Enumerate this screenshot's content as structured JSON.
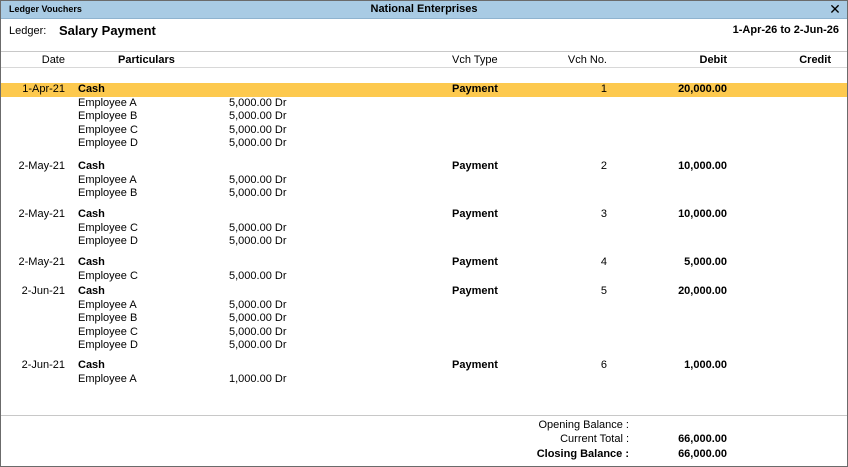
{
  "window": {
    "left_title": "Ledger Vouchers",
    "center_title": "National Enterprises",
    "close_glyph": "✕"
  },
  "ledger": {
    "label": "Ledger:",
    "name": "Salary Payment",
    "period": "1-Apr-26 to 2-Jun-26"
  },
  "columns": {
    "date": "Date",
    "particulars": "Particulars",
    "vch_type": "Vch Type",
    "vch_no": "Vch No.",
    "debit": "Debit",
    "credit": "Credit"
  },
  "vouchers": [
    {
      "date": "1-Apr-21",
      "particulars": "Cash",
      "vch_type": "Payment",
      "vch_no": "1",
      "debit": "20,000.00",
      "selected": true,
      "details": [
        {
          "name": "Employee A",
          "amount": "5,000.00 Dr"
        },
        {
          "name": "Employee B",
          "amount": "5,000.00 Dr"
        },
        {
          "name": "Employee C",
          "amount": "5,000.00 Dr"
        },
        {
          "name": "Employee D",
          "amount": "5,000.00 Dr"
        }
      ]
    },
    {
      "date": "2-May-21",
      "particulars": "Cash",
      "vch_type": "Payment",
      "vch_no": "2",
      "debit": "10,000.00",
      "selected": false,
      "details": [
        {
          "name": "Employee A",
          "amount": "5,000.00 Dr"
        },
        {
          "name": "Employee B",
          "amount": "5,000.00 Dr"
        }
      ]
    },
    {
      "date": "2-May-21",
      "particulars": "Cash",
      "vch_type": "Payment",
      "vch_no": "3",
      "debit": "10,000.00",
      "selected": false,
      "details": [
        {
          "name": "Employee C",
          "amount": "5,000.00 Dr"
        },
        {
          "name": "Employee D",
          "amount": "5,000.00 Dr"
        }
      ]
    },
    {
      "date": "2-May-21",
      "particulars": "Cash",
      "vch_type": "Payment",
      "vch_no": "4",
      "debit": "5,000.00",
      "selected": false,
      "details": [
        {
          "name": "Employee C",
          "amount": "5,000.00 Dr"
        }
      ]
    },
    {
      "date": "2-Jun-21",
      "particulars": "Cash",
      "vch_type": "Payment",
      "vch_no": "5",
      "debit": "20,000.00",
      "selected": false,
      "details": [
        {
          "name": "Employee A",
          "amount": "5,000.00 Dr"
        },
        {
          "name": "Employee B",
          "amount": "5,000.00 Dr"
        },
        {
          "name": "Employee C",
          "amount": "5,000.00 Dr"
        },
        {
          "name": "Employee D",
          "amount": "5,000.00 Dr"
        }
      ]
    },
    {
      "date": "2-Jun-21",
      "particulars": "Cash",
      "vch_type": "Payment",
      "vch_no": "6",
      "debit": "1,000.00",
      "selected": false,
      "details": [
        {
          "name": "Employee A",
          "amount": "1,000.00 Dr"
        }
      ]
    }
  ],
  "footer": {
    "opening_label": "Opening Balance :",
    "opening_value": "",
    "current_label": "Current Total :",
    "current_value": "66,000.00",
    "closing_label": "Closing Balance :",
    "closing_value": "66,000.00"
  },
  "colors": {
    "title_bar": "#a9cbe4",
    "selected_row": "#fdc94e"
  }
}
